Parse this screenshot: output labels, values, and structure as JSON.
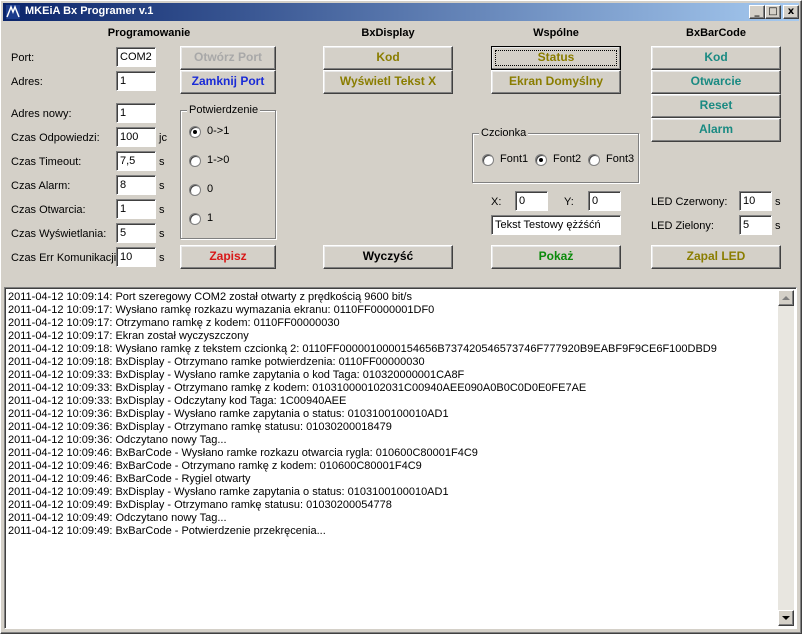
{
  "window": {
    "title": "MKEiA Bx Programer v.1",
    "icon": "app-logo-icon",
    "controls": {
      "minimize": "_",
      "maximize": "□",
      "close": "x"
    }
  },
  "colors": {
    "titlebar_start": "#0a246a",
    "titlebar_end": "#a6caf0",
    "btn_gray": "#a8a8a8",
    "btn_blue": "#1a2bd6",
    "btn_red": "#d81818",
    "btn_olive": "#8a7d00",
    "btn_teal": "#1a8a82",
    "btn_green": "#0a8a0a",
    "btn_black": "#000000"
  },
  "programowanie": {
    "title": "Programowanie",
    "port_label": "Port:",
    "port_value": "COM2",
    "adres_label": "Adres:",
    "adres_value": "1",
    "open_port": "Otwórz Port",
    "close_port": "Zamknij Port",
    "fields": [
      {
        "label": "Adres nowy:",
        "value": "1",
        "unit": ""
      },
      {
        "label": "Czas Odpowiedzi:",
        "value": "100",
        "unit": "jc"
      },
      {
        "label": "Czas Timeout:",
        "value": "7,5",
        "unit": "s"
      },
      {
        "label": "Czas Alarm:",
        "value": "8",
        "unit": "s"
      },
      {
        "label": "Czas Otwarcia:",
        "value": "1",
        "unit": "s"
      },
      {
        "label": "Czas Wyświetlania:",
        "value": "5",
        "unit": "s"
      },
      {
        "label": "Czas Err Komunikacji:",
        "value": "10",
        "unit": "s"
      }
    ],
    "potwierdzenie": {
      "title": "Potwierdzenie",
      "options": [
        "0->1",
        "1->0",
        "0",
        "1"
      ],
      "selected": "0->1"
    },
    "save": "Zapisz"
  },
  "bxdisplay": {
    "title": "BxDisplay",
    "kod": "Kod",
    "show_text": "Wyświetl Tekst X",
    "clear": "Wyczyść"
  },
  "wspolne": {
    "title": "Wspólne",
    "status": "Status",
    "default_screen": "Ekran Domyślny",
    "czcionka": {
      "title": "Czcionka",
      "options": [
        "Font1",
        "Font2",
        "Font3"
      ],
      "selected": "Font2"
    },
    "x_label": "X:",
    "x_value": "0",
    "y_label": "Y:",
    "y_value": "0",
    "text_value": "Tekst Testowy ężźśćń",
    "show": "Pokaż"
  },
  "bxbarcode": {
    "title": "BxBarCode",
    "kod": "Kod",
    "open": "Otwarcie",
    "reset": "Reset",
    "alarm": "Alarm",
    "led_red_label": "LED Czerwony:",
    "led_red_value": "10",
    "led_red_unit": "s",
    "led_green_label": "LED Zielony:",
    "led_green_value": "5",
    "led_green_unit": "s",
    "led_on": "Zapal LED"
  },
  "log": [
    "2011-04-12 10:09:14: Port szeregowy COM2 został otwarty z prędkością 9600 bit/s",
    "2011-04-12 10:09:17: Wysłano ramkę rozkazu wymazania ekranu:  0110FF0000001DF0",
    "2011-04-12 10:09:17: Otrzymano ramkę z kodem:  0110FF00000030",
    "2011-04-12 10:09:17: Ekran został wyczyszczony",
    "2011-04-12 10:09:18: Wysłano ramkę z tekstem czcionką 2:  0110FF0000010000154656B737420546573746F777920B9EABF9F9CE6F100DBD9",
    "2011-04-12 10:09:18: BxDisplay - Otrzymano ramke potwierdzenia:  0110FF00000030",
    "2011-04-12 10:09:33: BxDisplay - Wysłano ramke zapytania o kod Taga:  010320000001CA8F",
    "2011-04-12 10:09:33: BxDisplay - Otrzymano ramkę z kodem:  010310000102031C00940AEE090A0B0C0D0E0FE7AE",
    "2011-04-12 10:09:33: BxDisplay - Odczytany kod Taga:  1C00940AEE",
    "2011-04-12 10:09:36: BxDisplay - Wysłano ramke zapytania o status:  0103100100010AD1",
    "2011-04-12 10:09:36: BxDisplay - Otrzymano ramkę statusu:  01030200018479",
    "2011-04-12 10:09:36: Odczytano nowy Tag...",
    "2011-04-12 10:09:46: BxBarCode - Wysłano ramke rozkazu otwarcia rygla:  010600C80001F4C9",
    "2011-04-12 10:09:46: BxBarCode - Otrzymano ramkę z kodem:  010600C80001F4C9",
    "2011-04-12 10:09:46: BxBarCode - Rygiel otwarty",
    "2011-04-12 10:09:49: BxDisplay - Wysłano ramke zapytania o status:  0103100100010AD1",
    "2011-04-12 10:09:49: BxDisplay - Otrzymano ramkę statusu:  01030200054778",
    "2011-04-12 10:09:49: Odczytano nowy Tag...",
    "2011-04-12 10:09:49: BxBarCode - Potwierdzenie przekręcenia..."
  ]
}
